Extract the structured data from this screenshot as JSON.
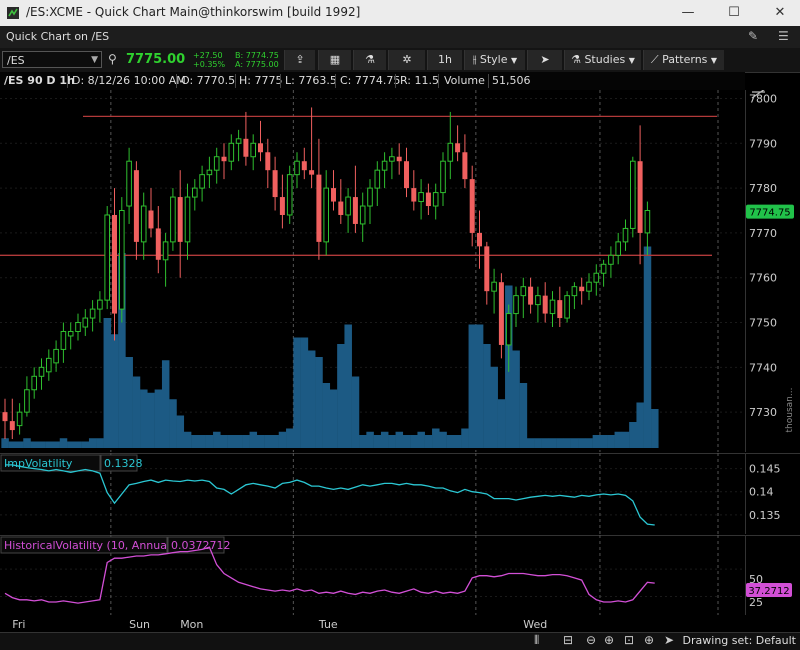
{
  "window": {
    "title": "/ES:XCME - Quick Chart Main@thinkorswim [build 1992]",
    "minimize": "—",
    "maximize": "☐",
    "close": "✕"
  },
  "toolbar": {
    "title": "Quick Chart on /ES",
    "pin_icon": "pin-icon",
    "menu_icon": "menu-icon"
  },
  "quote": {
    "symbol": "/ES",
    "price": "7775.00",
    "change": "+27.50",
    "change_pct": "+0.35%",
    "bid": "B: 7774.75",
    "ask": "A: 7775.00"
  },
  "buttons": {
    "timeframe": "1h",
    "style": "Style",
    "studies": "Studies",
    "patterns": "Patterns"
  },
  "infobar": {
    "label": "/ES 90 D 1h",
    "date": "D: 8/12/26 10:00 AM",
    "open": "O: 7770.5",
    "high": "H: 7775",
    "low": "L: 7763.5",
    "close": "C: 7774.75",
    "range": "R: 11.5",
    "volume_label": "Volume",
    "volume": "51,506"
  },
  "colors": {
    "up": "#2fbf2f",
    "down": "#f0605f",
    "volume": "#1c5a84",
    "resistance": "#b23a3a",
    "iv_line": "#2bc7d3",
    "hv_line": "#d24fd6",
    "last_price_bg": "#21c24a"
  },
  "price_axis": {
    "ticks": [
      "7800",
      "7790",
      "7780",
      "7770",
      "7760",
      "7750",
      "7740",
      "7730"
    ],
    "last_label": "7774.75"
  },
  "volume_axis": {
    "label": "thousan..."
  },
  "time_axis": {
    "labels": [
      "Fri",
      "Sun",
      "Mon",
      "Tue",
      "Wed"
    ]
  },
  "iv": {
    "title": "ImpVolatility",
    "value": "0.1328",
    "ticks": [
      "0.145",
      "0.14",
      "0.135"
    ]
  },
  "hv": {
    "title": "HistoricalVolatility (10, Annual)",
    "value": "0.0372712",
    "ticks": [
      "50",
      "25"
    ],
    "last_label": "37.2712"
  },
  "status": {
    "drawing_set": "Drawing set: Default"
  },
  "chart_data": {
    "type": "candlestick",
    "y_range": [
      7722,
      7801
    ],
    "levels": [
      7796,
      7765
    ],
    "last": 7774.75,
    "candles": [
      [
        7730,
        7733,
        7724,
        7728
      ],
      [
        7728,
        7733,
        7724,
        7726
      ],
      [
        7727,
        7732,
        7725,
        7730
      ],
      [
        7730,
        7738,
        7729,
        7735
      ],
      [
        7735,
        7740,
        7733,
        7738
      ],
      [
        7738,
        7742,
        7735,
        7740
      ],
      [
        7739,
        7744,
        7737,
        7742
      ],
      [
        7741,
        7746,
        7739,
        7744
      ],
      [
        7744,
        7750,
        7741,
        7748
      ],
      [
        7747,
        7750,
        7744,
        7748
      ],
      [
        7748,
        7752,
        7746,
        7750
      ],
      [
        7749,
        7753,
        7747,
        7751
      ],
      [
        7751,
        7755,
        7748,
        7753
      ],
      [
        7753,
        7757,
        7750,
        7755
      ],
      [
        7755,
        7776,
        7753,
        7774
      ],
      [
        7774,
        7780,
        7746,
        7752
      ],
      [
        7753,
        7778,
        7750,
        7775
      ],
      [
        7776,
        7789,
        7772,
        7786
      ],
      [
        7784,
        7786,
        7764,
        7768
      ],
      [
        7768,
        7779,
        7764,
        7776
      ],
      [
        7775,
        7780,
        7769,
        7771
      ],
      [
        7771,
        7776,
        7761,
        7764
      ],
      [
        7764,
        7770,
        7758,
        7768
      ],
      [
        7768,
        7780,
        7766,
        7778
      ],
      [
        7778,
        7784,
        7760,
        7768
      ],
      [
        7768,
        7781,
        7764,
        7778
      ],
      [
        7778,
        7782,
        7775,
        7780
      ],
      [
        7780,
        7785,
        7777,
        7783
      ],
      [
        7783,
        7787,
        7780,
        7784
      ],
      [
        7784,
        7789,
        7781,
        7787
      ],
      [
        7787,
        7790,
        7782,
        7786
      ],
      [
        7786,
        7792,
        7784,
        7790
      ],
      [
        7790,
        7793,
        7786,
        7791
      ],
      [
        7791,
        7797,
        7785,
        7787
      ],
      [
        7787,
        7792,
        7784,
        7790
      ],
      [
        7790,
        7795,
        7786,
        7788
      ],
      [
        7788,
        7791,
        7780,
        7784
      ],
      [
        7784,
        7787,
        7775,
        7778
      ],
      [
        7778,
        7783,
        7771,
        7774
      ],
      [
        7774,
        7785,
        7772,
        7783
      ],
      [
        7783,
        7788,
        7780,
        7786
      ],
      [
        7786,
        7789,
        7782,
        7784
      ],
      [
        7784,
        7798,
        7780,
        7783
      ],
      [
        7783,
        7791,
        7764,
        7768
      ],
      [
        7768,
        7784,
        7765,
        7780
      ],
      [
        7780,
        7784,
        7775,
        7777
      ],
      [
        7777,
        7782,
        7772,
        7774
      ],
      [
        7774,
        7780,
        7770,
        7778
      ],
      [
        7778,
        7785,
        7770,
        7772
      ],
      [
        7772,
        7779,
        7768,
        7776
      ],
      [
        7776,
        7782,
        7772,
        7780
      ],
      [
        7780,
        7786,
        7776,
        7784
      ],
      [
        7784,
        7788,
        7780,
        7786
      ],
      [
        7786,
        7789,
        7782,
        7787
      ],
      [
        7787,
        7790,
        7783,
        7786
      ],
      [
        7786,
        7789,
        7778,
        7780
      ],
      [
        7780,
        7784,
        7775,
        7777
      ],
      [
        7777,
        7782,
        7773,
        7779
      ],
      [
        7779,
        7781,
        7774,
        7776
      ],
      [
        7776,
        7781,
        7773,
        7779
      ],
      [
        7779,
        7788,
        7776,
        7786
      ],
      [
        7786,
        7797,
        7782,
        7790
      ],
      [
        7790,
        7794,
        7786,
        7788
      ],
      [
        7788,
        7792,
        7780,
        7782
      ],
      [
        7782,
        7785,
        7767,
        7770
      ],
      [
        7770,
        7775,
        7762,
        7767
      ],
      [
        7767,
        7768,
        7754,
        7757
      ],
      [
        7757,
        7762,
        7752,
        7759
      ],
      [
        7759,
        7761,
        7742,
        7745
      ],
      [
        7745,
        7754,
        7739,
        7752
      ],
      [
        7752,
        7758,
        7749,
        7756
      ],
      [
        7756,
        7760,
        7751,
        7758
      ],
      [
        7758,
        7760,
        7752,
        7754
      ],
      [
        7754,
        7758,
        7750,
        7756
      ],
      [
        7756,
        7759,
        7750,
        7752
      ],
      [
        7752,
        7757,
        7749,
        7755
      ],
      [
        7755,
        7758,
        7749,
        7751
      ],
      [
        7751,
        7757,
        7750,
        7756
      ],
      [
        7756,
        7759,
        7753,
        7758
      ],
      [
        7758,
        7760,
        7754,
        7757
      ],
      [
        7757,
        7761,
        7755,
        7759
      ],
      [
        7759,
        7763,
        7756,
        7761
      ],
      [
        7761,
        7764,
        7758,
        7763
      ],
      [
        7763,
        7767,
        7760,
        7765
      ],
      [
        7765,
        7770,
        7763,
        7768
      ],
      [
        7768,
        7773,
        7766,
        7771
      ],
      [
        7771,
        7787,
        7769,
        7786
      ],
      [
        7786,
        7794,
        7763,
        7770
      ],
      [
        7770,
        7777,
        7765,
        7775
      ]
    ],
    "volume": [
      3,
      2,
      2,
      3,
      2,
      2,
      2,
      2,
      3,
      2,
      2,
      2,
      3,
      3,
      40,
      35,
      60,
      28,
      22,
      18,
      17,
      18,
      27,
      15,
      10,
      5,
      4,
      4,
      4,
      5,
      4,
      4,
      4,
      4,
      5,
      4,
      4,
      4,
      5,
      6,
      34,
      34,
      30,
      28,
      20,
      18,
      32,
      38,
      22,
      4,
      5,
      4,
      5,
      4,
      5,
      4,
      4,
      5,
      4,
      6,
      5,
      4,
      4,
      6,
      38,
      38,
      32,
      25,
      15,
      50,
      30,
      20,
      3,
      3,
      3,
      3,
      3,
      3,
      3,
      3,
      3,
      4,
      4,
      4,
      5,
      5,
      8,
      14,
      62,
      12
    ],
    "iv": [
      0.1458,
      0.1458,
      0.1455,
      0.1452,
      0.145,
      0.1448,
      0.1445,
      0.1448,
      0.1445,
      0.1442,
      0.1445,
      0.1448,
      0.1445,
      0.144,
      0.1398,
      0.1375,
      0.1395,
      0.1415,
      0.1418,
      0.1422,
      0.1425,
      0.142,
      0.1425,
      0.1423,
      0.1422,
      0.1425,
      0.1423,
      0.1425,
      0.1422,
      0.1408,
      0.1405,
      0.1395,
      0.1405,
      0.1415,
      0.1418,
      0.1415,
      0.1412,
      0.1408,
      0.1418,
      0.142,
      0.1425,
      0.142,
      0.1412,
      0.1412,
      0.1408,
      0.1405,
      0.1408,
      0.1405,
      0.141,
      0.1415,
      0.1412,
      0.1415,
      0.1418,
      0.1418,
      0.1415,
      0.1418,
      0.1415,
      0.1415,
      0.1412,
      0.1408,
      0.1408,
      0.1402,
      0.1398,
      0.1405,
      0.14,
      0.1398,
      0.1395,
      0.1385,
      0.1385,
      0.1385,
      0.1382,
      0.1385,
      0.1388,
      0.139,
      0.1392,
      0.139,
      0.1392,
      0.139,
      0.1388,
      0.1392,
      0.139,
      0.1393,
      0.1395,
      0.1393,
      0.1395,
      0.1392,
      0.138,
      0.1345,
      0.133,
      0.1328
    ],
    "hv": [
      28,
      24,
      22,
      22,
      21,
      22,
      20,
      20,
      21,
      20,
      19,
      20,
      21,
      22,
      56,
      60,
      60,
      61,
      62,
      62,
      63,
      63,
      64,
      65,
      66,
      66,
      67,
      68,
      70,
      54,
      46,
      42,
      38,
      36,
      34,
      32,
      31,
      30,
      31,
      30,
      32,
      30,
      31,
      28,
      29,
      28,
      30,
      28,
      27,
      29,
      28,
      30,
      31,
      29,
      28,
      30,
      32,
      29,
      28,
      30,
      28,
      29,
      28,
      30,
      42,
      44,
      44,
      43,
      44,
      46,
      46,
      46,
      45,
      44,
      44,
      45,
      45,
      44,
      42,
      40,
      27,
      22,
      20,
      20,
      21,
      20,
      22,
      30,
      38,
      37.27
    ],
    "day_boundaries": [
      15,
      40,
      65,
      82
    ],
    "day_labels": [
      "Fri",
      "Sun",
      "Mon",
      "Tue",
      "Wed"
    ],
    "day_label_index": [
      1,
      17,
      24,
      43,
      71
    ]
  }
}
